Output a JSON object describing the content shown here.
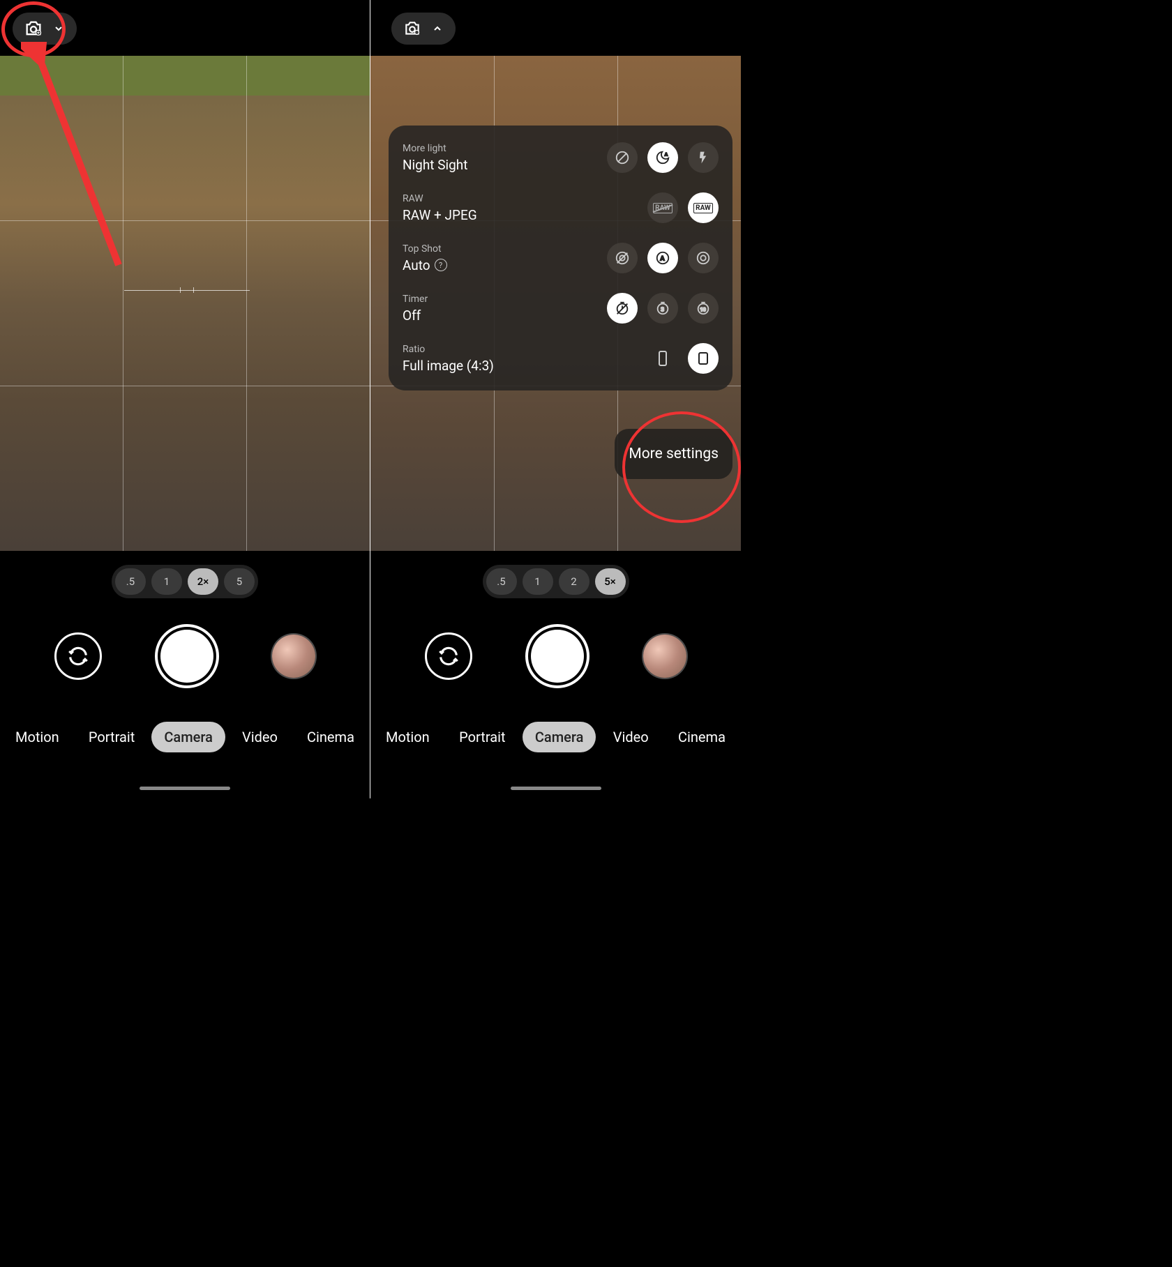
{
  "left": {
    "zoom": {
      "options": [
        ".5",
        "1",
        "2×",
        "5"
      ],
      "active": 2
    },
    "modes": [
      "Motion",
      "Portrait",
      "Camera",
      "Video",
      "Cinema"
    ],
    "mode_active": 2
  },
  "right": {
    "zoom": {
      "options": [
        ".5",
        "1",
        "2",
        "5×"
      ],
      "active": 3
    },
    "modes": [
      "Motion",
      "Portrait",
      "Camera",
      "Video",
      "Cinema"
    ],
    "mode_active": 2,
    "settings": {
      "more_light": {
        "title": "More light",
        "value": "Night Sight",
        "selected": 1
      },
      "raw": {
        "title": "RAW",
        "value": "RAW + JPEG",
        "selected": 1
      },
      "top_shot": {
        "title": "Top Shot",
        "value": "Auto",
        "selected": 1
      },
      "timer": {
        "title": "Timer",
        "value": "Off",
        "selected": 0
      },
      "ratio": {
        "title": "Ratio",
        "value": "Full image (4:3)",
        "selected": 1
      }
    },
    "more_settings": "More settings"
  }
}
